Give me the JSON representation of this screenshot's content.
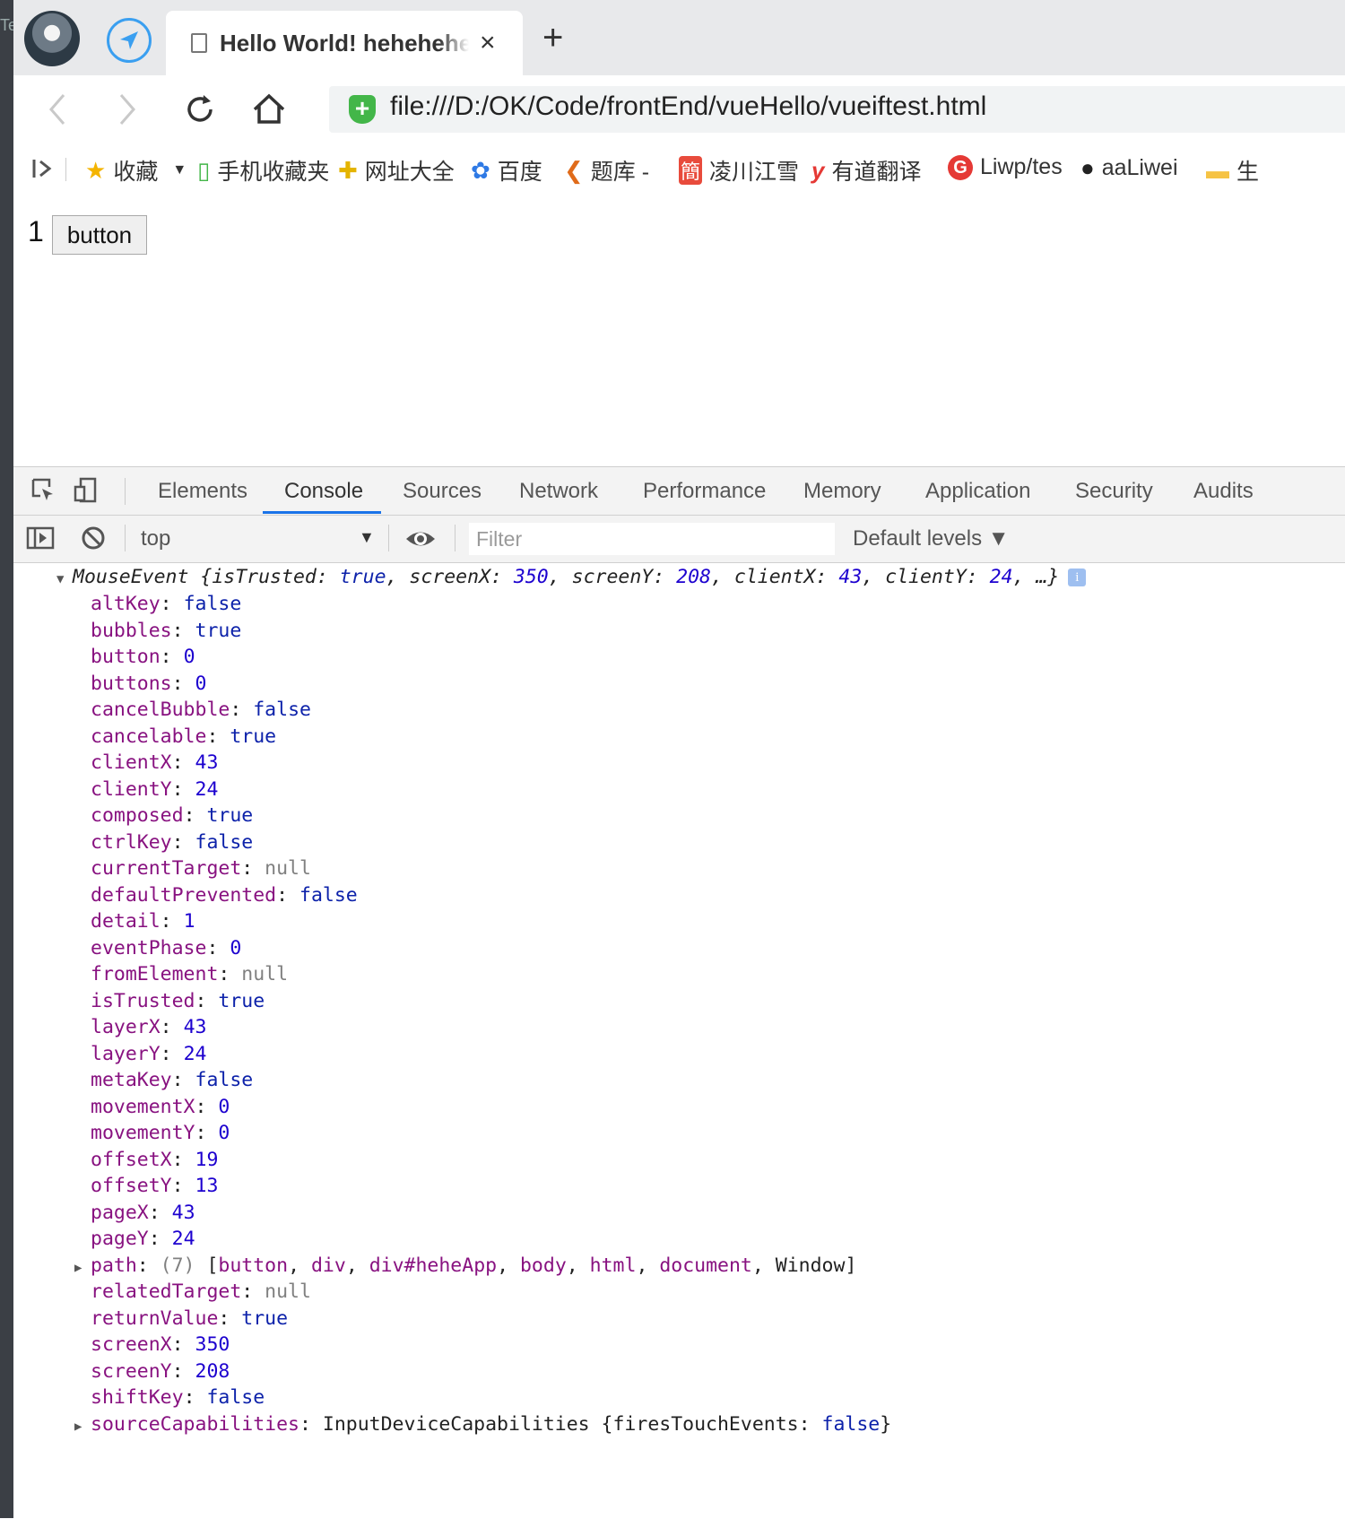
{
  "browser": {
    "tab_title": "Hello World! heheheheheheh",
    "tab_close": "×",
    "new_tab": "+",
    "url": "file:///D:/OK/Code/frontEnd/vueHello/vueiftest.html",
    "url_badge": "+",
    "left_edge_text": "Te"
  },
  "bookmarks": [
    {
      "icon": "★",
      "label": "收藏",
      "color": "#f4b400"
    },
    {
      "icon": "▯",
      "label": "手机收藏夹",
      "color": "#43b649"
    },
    {
      "icon": "✚",
      "label": "网址大全",
      "color": "#e4b400"
    },
    {
      "icon": "✿",
      "label": "百度",
      "color": "#2f7ae5"
    },
    {
      "icon": "❮",
      "label": "题库 -",
      "color": "#e06b1a"
    },
    {
      "icon": "簡",
      "label": "凌川江雪",
      "color": "#e84b3c"
    },
    {
      "icon": "y",
      "label": "有道翻译",
      "color": "#e53935"
    },
    {
      "icon": "G",
      "label": "Liwp/tes",
      "color": "#e53935"
    },
    {
      "icon": "●",
      "label": "aaLiwei",
      "color": "#222222"
    },
    {
      "icon": "▬",
      "label": "生",
      "color": "#f6c344"
    }
  ],
  "page": {
    "counter": "1",
    "button_label": "button"
  },
  "devtools": {
    "tabs": [
      "Elements",
      "Console",
      "Sources",
      "Network",
      "Performance",
      "Memory",
      "Application",
      "Security",
      "Audits"
    ],
    "active_tab": "Console",
    "context": "top",
    "filter_placeholder": "Filter",
    "levels": "Default levels ▼"
  },
  "console": {
    "summary": {
      "class": "MouseEvent",
      "text_a": " {isTrusted: ",
      "isTrusted": "true",
      "text_b": ", screenX: ",
      "screenX": "350",
      "text_c": ", screenY: ",
      "screenY": "208",
      "text_d": ", clientX: ",
      "clientX": "43",
      "text_e": ", clientY: ",
      "clientY": "24",
      "text_f": ", …}",
      "info": "i"
    },
    "props": [
      {
        "key": "altKey",
        "value": "false",
        "type": "bool"
      },
      {
        "key": "bubbles",
        "value": "true",
        "type": "bool"
      },
      {
        "key": "button",
        "value": "0",
        "type": "num"
      },
      {
        "key": "buttons",
        "value": "0",
        "type": "num"
      },
      {
        "key": "cancelBubble",
        "value": "false",
        "type": "bool"
      },
      {
        "key": "cancelable",
        "value": "true",
        "type": "bool"
      },
      {
        "key": "clientX",
        "value": "43",
        "type": "num"
      },
      {
        "key": "clientY",
        "value": "24",
        "type": "num"
      },
      {
        "key": "composed",
        "value": "true",
        "type": "bool"
      },
      {
        "key": "ctrlKey",
        "value": "false",
        "type": "bool"
      },
      {
        "key": "currentTarget",
        "value": "null",
        "type": "nul"
      },
      {
        "key": "defaultPrevented",
        "value": "false",
        "type": "bool"
      },
      {
        "key": "detail",
        "value": "1",
        "type": "num"
      },
      {
        "key": "eventPhase",
        "value": "0",
        "type": "num"
      },
      {
        "key": "fromElement",
        "value": "null",
        "type": "nul"
      },
      {
        "key": "isTrusted",
        "value": "true",
        "type": "bool"
      },
      {
        "key": "layerX",
        "value": "43",
        "type": "num"
      },
      {
        "key": "layerY",
        "value": "24",
        "type": "num"
      },
      {
        "key": "metaKey",
        "value": "false",
        "type": "bool"
      },
      {
        "key": "movementX",
        "value": "0",
        "type": "num"
      },
      {
        "key": "movementY",
        "value": "0",
        "type": "num"
      },
      {
        "key": "offsetX",
        "value": "19",
        "type": "num"
      },
      {
        "key": "offsetY",
        "value": "13",
        "type": "num"
      },
      {
        "key": "pageX",
        "value": "43",
        "type": "num"
      },
      {
        "key": "pageY",
        "value": "24",
        "type": "num"
      }
    ],
    "path": {
      "key": "path",
      "count": "(7)",
      "items": [
        "button",
        "div",
        "div#heheApp",
        "body",
        "html",
        "document",
        "Window"
      ]
    },
    "props2": [
      {
        "key": "relatedTarget",
        "value": "null",
        "type": "nul"
      },
      {
        "key": "returnValue",
        "value": "true",
        "type": "bool"
      },
      {
        "key": "screenX",
        "value": "350",
        "type": "num"
      },
      {
        "key": "screenY",
        "value": "208",
        "type": "num"
      },
      {
        "key": "shiftKey",
        "value": "false",
        "type": "bool"
      }
    ],
    "source_caps": {
      "key": "sourceCapabilities",
      "value_a": "InputDeviceCapabilities {firesTouchEvents: ",
      "value_b": "false",
      "value_c": "}"
    }
  }
}
